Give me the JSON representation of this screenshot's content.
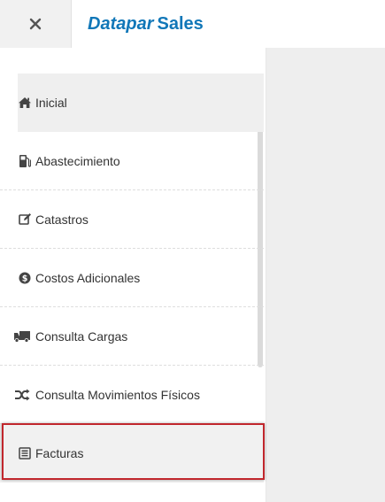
{
  "header": {
    "close_icon": "close-icon",
    "brand_part1": "Datapar",
    "brand_part2": "Sales",
    "brand_color": "#1177b8"
  },
  "sidebar": {
    "items": [
      {
        "label": "Inicial",
        "icon": "home-icon",
        "active": true
      },
      {
        "label": "Abastecimiento",
        "icon": "fuel-pump-icon"
      },
      {
        "label": "Catastros",
        "icon": "edit-icon"
      },
      {
        "label": "Costos Adicionales",
        "icon": "dollar-circle-icon"
      },
      {
        "label": "Consulta Cargas",
        "icon": "truck-icon"
      },
      {
        "label": "Consulta Movimientos Físicos",
        "icon": "shuffle-icon"
      },
      {
        "label": "Facturas",
        "icon": "invoice-icon",
        "highlighted": true
      }
    ],
    "highlight_color": "#c1272d"
  }
}
